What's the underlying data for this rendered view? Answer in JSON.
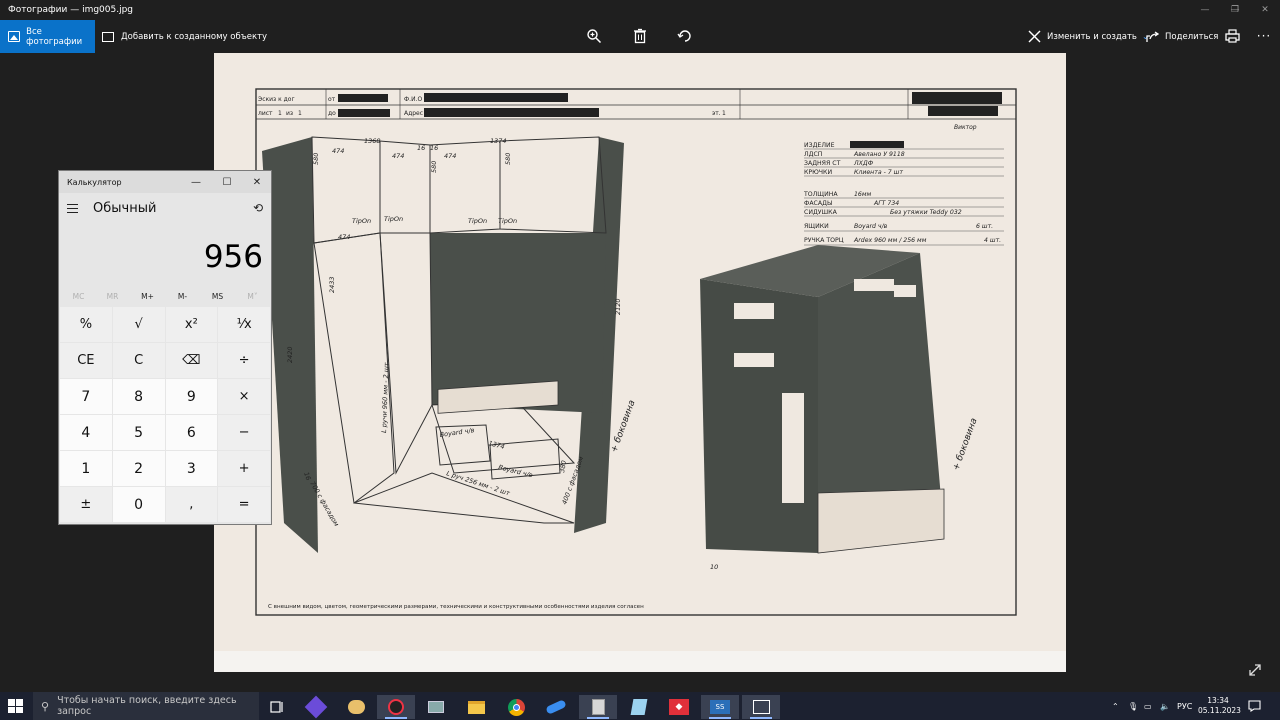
{
  "window": {
    "title": "Фотографии — img005.jpg"
  },
  "toolbar": {
    "all_photos": "Все фотографии",
    "add_to_creation": "Добавить к созданному объекту",
    "edit_create": "Изменить и создать",
    "share": "Поделиться",
    "icons": [
      "zoom-in-icon",
      "delete-icon",
      "rotate-icon",
      "edit-icon",
      "share-icon",
      "print-icon",
      "more-icon"
    ]
  },
  "drawing": {
    "header": {
      "row1_left": "Эскиз к дог",
      "row1_from": "от",
      "row1_fio": "Ф.И.О",
      "row2_left": "лист",
      "row2_num": "1",
      "row2_of": "из",
      "row2_total": "1",
      "row2_to": "до",
      "row2_address": "Адрес",
      "row2_st": "эт.",
      "row2_st_num": "1",
      "signature": "Виктор"
    },
    "spec": [
      {
        "label": "ИЗДЕЛИЕ",
        "value": ""
      },
      {
        "label": "ЛДСП",
        "value": "Авелано У 9118"
      },
      {
        "label": "ЗАДНЯЯ СТ",
        "value": "ЛХДФ"
      },
      {
        "label": "КРЮЧКИ",
        "value": "Клиента - 7 шт"
      },
      {
        "label": "ТОЛЩИНА",
        "value": "16мм"
      },
      {
        "label": "ФАСАДЫ",
        "value": "АГТ 734"
      },
      {
        "label": "СИДУШКА",
        "value": "Без утяжки   Teddy 032"
      },
      {
        "label": "ЯЩИКИ",
        "value": "Boyard ч/в",
        "extra": "6 шт."
      },
      {
        "label": "РУЧКА ТОРЦ",
        "value": "Ardex 960 мм / 256 мм",
        "extra": "4 шт."
      }
    ],
    "dims": [
      "1368",
      "474",
      "474",
      "16",
      "16",
      "474",
      "1374",
      "580",
      "580",
      "580",
      "TipOn",
      "TipOn",
      "TipOn",
      "TipOn",
      "474",
      "2433",
      "2420",
      "2120",
      "1374",
      "Boyard ч/в",
      "Boyard ч/в",
      "380",
      "L ручи 960 мм - 2 шт",
      "L руч 256 мм - 2 шт",
      "700 с фасадом",
      "400 с фасадом",
      "16",
      "+ боковина",
      "+ боковина",
      "10"
    ],
    "footer": "С внешним видом, цветом, геометрическими размерами, техническими и конструктивными особенностями изделия согласен"
  },
  "calculator": {
    "title": "Калькулятор",
    "mode": "Обычный",
    "display": "956",
    "memory": [
      {
        "label": "MC",
        "enabled": false
      },
      {
        "label": "MR",
        "enabled": false
      },
      {
        "label": "M+",
        "enabled": true
      },
      {
        "label": "M-",
        "enabled": true
      },
      {
        "label": "MS",
        "enabled": true
      },
      {
        "label": "M˅",
        "enabled": false
      }
    ],
    "keys": [
      {
        "label": "%",
        "kind": "op",
        "name": "percent-key"
      },
      {
        "label": "√",
        "kind": "op",
        "name": "sqrt-key"
      },
      {
        "label": "x²",
        "kind": "op",
        "name": "square-key"
      },
      {
        "label": "¹⁄x",
        "kind": "op",
        "name": "reciprocal-key"
      },
      {
        "label": "CE",
        "kind": "op",
        "name": "clear-entry-key"
      },
      {
        "label": "C",
        "kind": "op",
        "name": "clear-key"
      },
      {
        "label": "⌫",
        "kind": "op",
        "name": "backspace-key"
      },
      {
        "label": "÷",
        "kind": "op",
        "name": "divide-key"
      },
      {
        "label": "7",
        "kind": "num",
        "name": "digit-7-key"
      },
      {
        "label": "8",
        "kind": "num",
        "name": "digit-8-key"
      },
      {
        "label": "9",
        "kind": "num",
        "name": "digit-9-key"
      },
      {
        "label": "×",
        "kind": "op",
        "name": "multiply-key"
      },
      {
        "label": "4",
        "kind": "num",
        "name": "digit-4-key"
      },
      {
        "label": "5",
        "kind": "num",
        "name": "digit-5-key"
      },
      {
        "label": "6",
        "kind": "num",
        "name": "digit-6-key"
      },
      {
        "label": "−",
        "kind": "op",
        "name": "minus-key"
      },
      {
        "label": "1",
        "kind": "num",
        "name": "digit-1-key"
      },
      {
        "label": "2",
        "kind": "num",
        "name": "digit-2-key"
      },
      {
        "label": "3",
        "kind": "num",
        "name": "digit-3-key"
      },
      {
        "label": "+",
        "kind": "op",
        "name": "plus-key"
      },
      {
        "label": "±",
        "kind": "op",
        "name": "negate-key"
      },
      {
        "label": "0",
        "kind": "num",
        "name": "digit-0-key"
      },
      {
        "label": ",",
        "kind": "op",
        "name": "decimal-key"
      },
      {
        "label": "=",
        "kind": "op",
        "name": "equals-key"
      }
    ]
  },
  "taskbar": {
    "search_placeholder": "Чтобы начать поиск, введите здесь запрос",
    "language": "РУС",
    "time": "13:34",
    "date": "05.11.2023"
  },
  "colors": {
    "accent": "#0a72c9",
    "background": "#1f1f1f",
    "taskbar": "#1c2130",
    "paper": "#efe8e0"
  }
}
